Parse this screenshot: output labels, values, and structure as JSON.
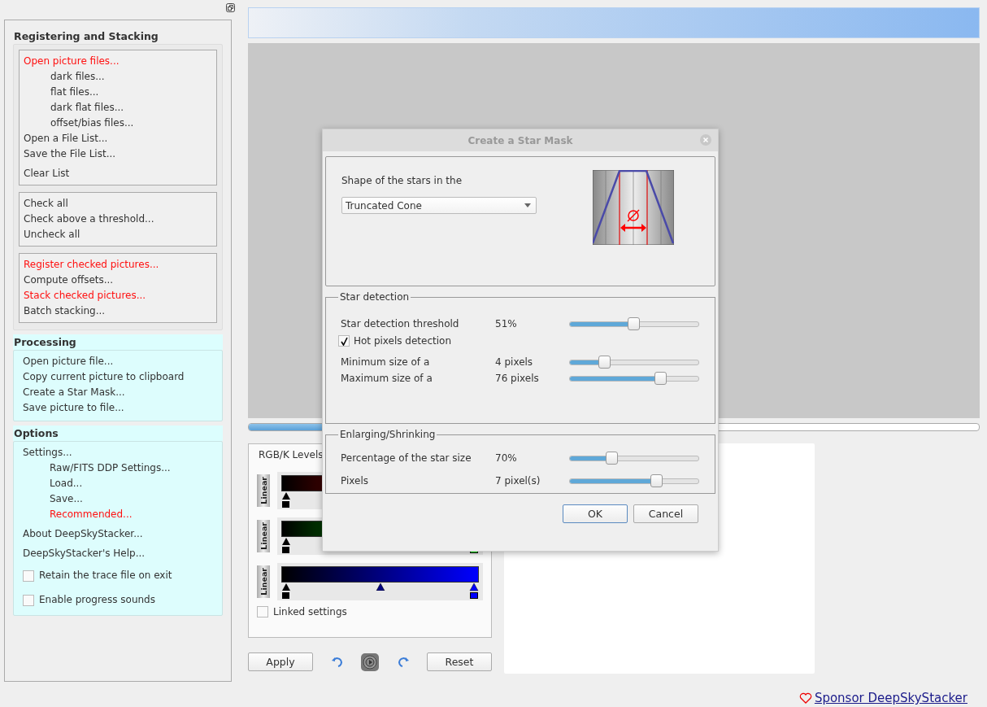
{
  "sidebar": {
    "sections": [
      {
        "title": "Registering and Stacking",
        "active": false,
        "groups": [
          [
            {
              "kind": "action",
              "label": "Open picture files...",
              "highlighted": true,
              "children": [
                {
                  "kind": "action",
                  "label": "dark files...",
                  "highlighted": false
                },
                {
                  "kind": "action",
                  "label": "flat files...",
                  "highlighted": false
                },
                {
                  "kind": "action",
                  "label": "dark flat files...",
                  "highlighted": false
                },
                {
                  "kind": "action",
                  "label": "offset/bias files...",
                  "highlighted": false
                }
              ]
            },
            {
              "kind": "action",
              "label": "Open a File List...",
              "highlighted": false
            },
            {
              "kind": "action",
              "label": "Save the File List...",
              "highlighted": false
            },
            {
              "kind": "spacer"
            },
            {
              "kind": "action",
              "label": "Clear List",
              "highlighted": false
            }
          ],
          [
            {
              "kind": "action",
              "label": "Check all",
              "highlighted": false
            },
            {
              "kind": "action",
              "label": "Check above a threshold...",
              "highlighted": false
            },
            {
              "kind": "action",
              "label": "Uncheck all",
              "highlighted": false
            }
          ],
          [
            {
              "kind": "action",
              "label": "Register checked pictures...",
              "highlighted": true
            },
            {
              "kind": "action",
              "label": "Compute offsets...",
              "highlighted": false
            },
            {
              "kind": "action",
              "label": "Stack checked pictures...",
              "highlighted": true
            },
            {
              "kind": "action",
              "label": "Batch stacking...",
              "highlighted": false
            }
          ]
        ]
      },
      {
        "title": "Processing",
        "active": true,
        "groups": [
          [
            {
              "kind": "action",
              "label": "Open picture file...",
              "highlighted": false
            },
            {
              "kind": "action",
              "label": "Copy current picture to clipboard",
              "highlighted": false
            },
            {
              "kind": "action",
              "label": "Create a Star Mask...",
              "highlighted": false
            },
            {
              "kind": "action",
              "label": "Save picture to file...",
              "highlighted": false
            }
          ]
        ]
      },
      {
        "title": "Options",
        "active": true,
        "groups": [
          [
            {
              "kind": "action",
              "label": "Settings...",
              "highlighted": false,
              "children": [
                {
                  "kind": "action",
                  "label": "Raw/FITS DDP Settings...",
                  "highlighted": false
                },
                {
                  "kind": "action",
                  "label": "Load...",
                  "highlighted": false
                },
                {
                  "kind": "action",
                  "label": "Save...",
                  "highlighted": false
                },
                {
                  "kind": "action",
                  "label": "Recommended...",
                  "highlighted": true
                }
              ]
            },
            {
              "kind": "spacer"
            },
            {
              "kind": "action",
              "label": "About DeepSkyStacker...",
              "highlighted": false
            },
            {
              "kind": "spacer"
            },
            {
              "kind": "action",
              "label": "DeepSkyStacker's Help...",
              "highlighted": false
            },
            {
              "kind": "spacer"
            },
            {
              "kind": "checkbox",
              "label": "Retain the trace file on exit",
              "checked": false
            },
            {
              "kind": "spacer"
            },
            {
              "kind": "checkbox",
              "label": "Enable progress sounds",
              "checked": false
            }
          ]
        ]
      }
    ]
  },
  "progress": {
    "level": 0.1
  },
  "levels": {
    "tab": "RGB/K Levels",
    "channels": [
      {
        "mode": "Linear",
        "kind": "red"
      },
      {
        "mode": "Linear",
        "kind": "green"
      },
      {
        "mode": "Linear",
        "kind": "blue"
      }
    ],
    "linked": {
      "label": "Linked settings",
      "checked": false
    }
  },
  "buttons": {
    "apply": "Apply",
    "reset": "Reset"
  },
  "sponsor": "Sponsor DeepSkyStacker",
  "dialog": {
    "title": "Create a Star Mask",
    "shape": {
      "label": "Shape of the stars in the",
      "value": "Truncated Cone"
    },
    "groups": [
      {
        "title": "Star detection",
        "rows": [
          {
            "kind": "slider",
            "label": "Star detection threshold",
            "reading": "51%",
            "level": 0.5
          },
          {
            "kind": "checkbox",
            "label": "Hot pixels detection",
            "checked": true
          },
          {
            "kind": "slider",
            "label": "Minimum size of a",
            "reading": "4 pixels",
            "level": 0.27
          },
          {
            "kind": "slider",
            "label": "Maximum size of a",
            "reading": "76 pixels",
            "level": 0.71
          }
        ]
      },
      {
        "title": "Enlarging/Shrinking",
        "rows": [
          {
            "kind": "slider",
            "label": "Percentage of the star size",
            "reading": "70%",
            "level": 0.33
          },
          {
            "kind": "slider",
            "label": "Pixels",
            "reading": "7 pixel(s)",
            "level": 0.68
          }
        ]
      }
    ],
    "ok": "OK",
    "cancel": "Cancel"
  }
}
